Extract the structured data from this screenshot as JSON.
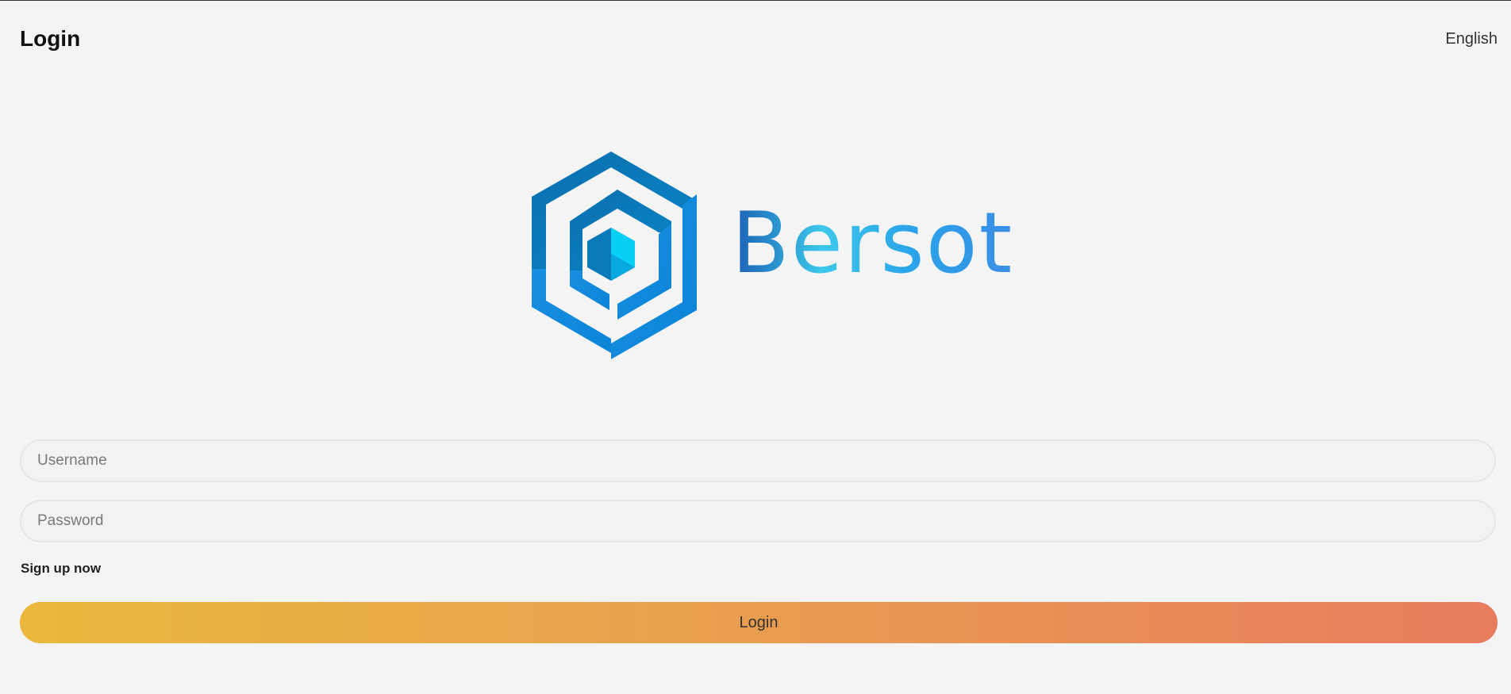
{
  "header": {
    "title": "Login",
    "language": "English"
  },
  "logo": {
    "wordmark": "Bersot",
    "icon": "hexagon-cube-logo-icon"
  },
  "form": {
    "username_placeholder": "Username",
    "username_value": "",
    "password_placeholder": "Password",
    "password_value": "",
    "signup_label": "Sign up now",
    "login_label": "Login"
  },
  "colors": {
    "background": "#f4f4f4",
    "logo_dark_blue": "#0a7ab8",
    "logo_blue": "#1e8fe0",
    "logo_cyan": "#08d0f5",
    "button_gradient_start": "#ebb83d",
    "button_gradient_end": "#e87b5e"
  }
}
